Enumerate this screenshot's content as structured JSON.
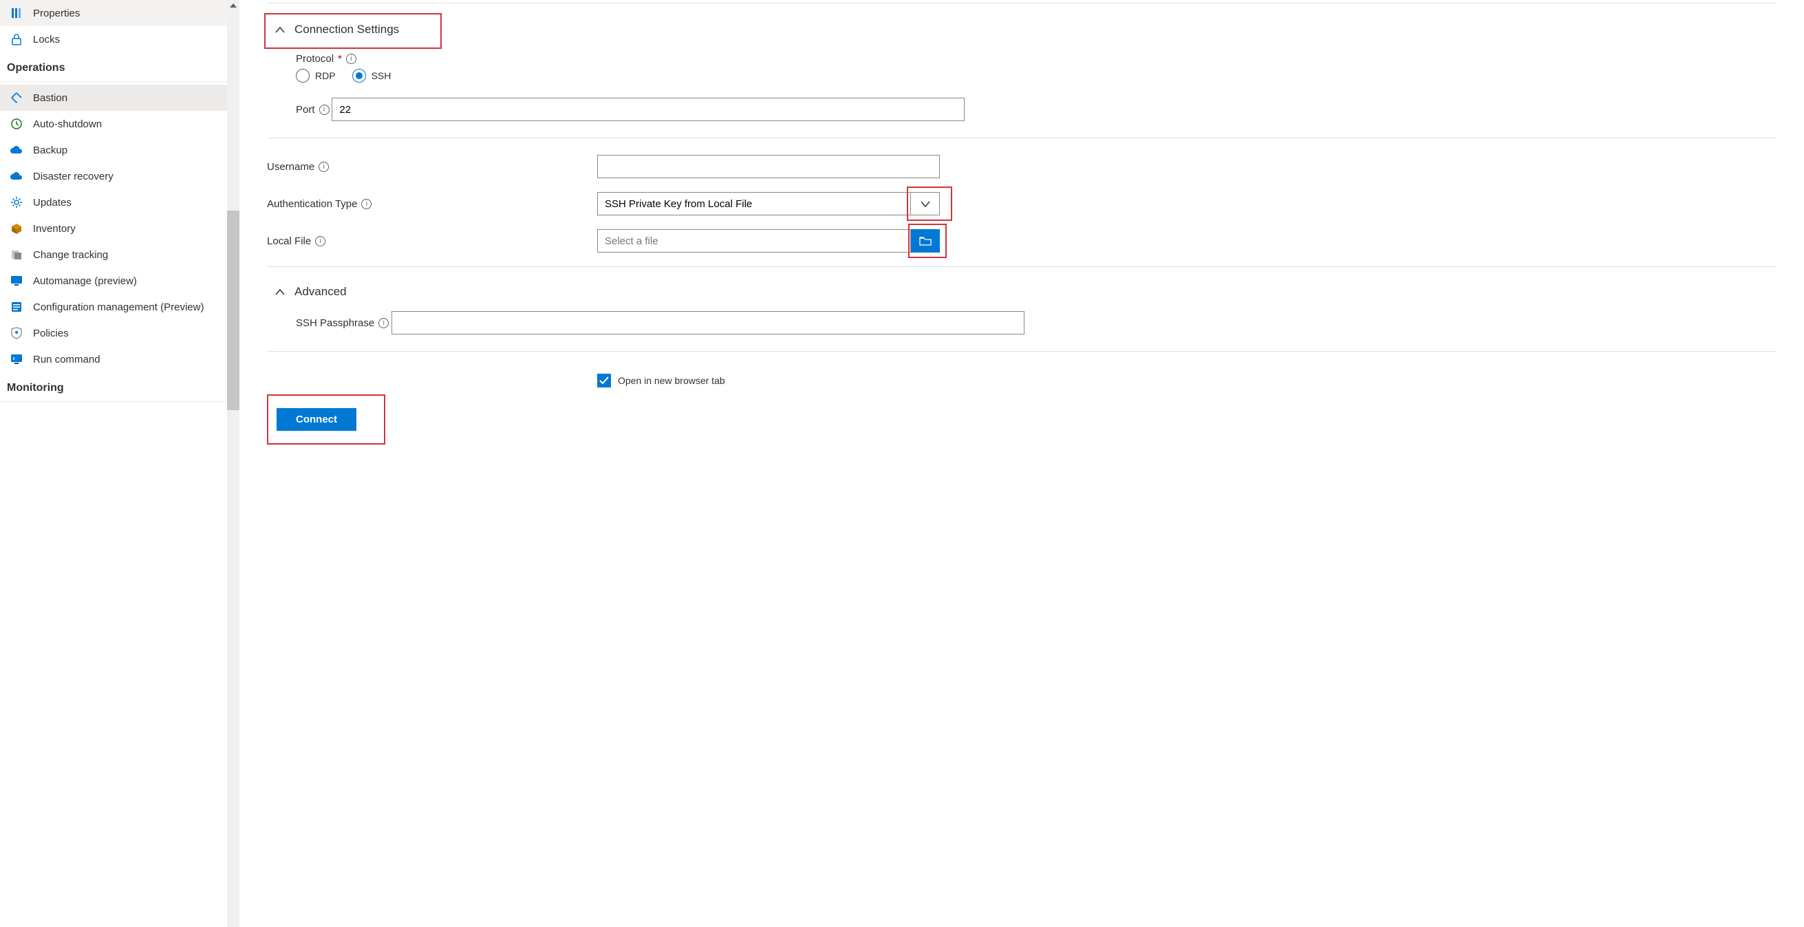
{
  "sidebar": {
    "sections": [
      {
        "items": [
          {
            "id": "properties",
            "label": "Properties"
          },
          {
            "id": "locks",
            "label": "Locks"
          }
        ]
      },
      {
        "header": "Operations",
        "items": [
          {
            "id": "bastion",
            "label": "Bastion",
            "active": true
          },
          {
            "id": "autoshutdown",
            "label": "Auto-shutdown"
          },
          {
            "id": "backup",
            "label": "Backup"
          },
          {
            "id": "dr",
            "label": "Disaster recovery"
          },
          {
            "id": "updates",
            "label": "Updates"
          },
          {
            "id": "inventory",
            "label": "Inventory"
          },
          {
            "id": "changetracking",
            "label": "Change tracking"
          },
          {
            "id": "automanage",
            "label": "Automanage (preview)"
          },
          {
            "id": "configmgmt",
            "label": "Configuration management (Preview)"
          },
          {
            "id": "policies",
            "label": "Policies"
          },
          {
            "id": "runcmd",
            "label": "Run command"
          }
        ]
      },
      {
        "header": "Monitoring",
        "items": []
      }
    ]
  },
  "main": {
    "connection_settings_title": "Connection Settings",
    "protocol": {
      "label": "Protocol",
      "options": {
        "rdp": "RDP",
        "ssh": "SSH"
      },
      "selected": "ssh"
    },
    "port": {
      "label": "Port",
      "value": "22"
    },
    "username": {
      "label": "Username",
      "value": ""
    },
    "auth_type": {
      "label": "Authentication Type",
      "value": "SSH Private Key from Local File"
    },
    "local_file": {
      "label": "Local File",
      "placeholder": "Select a file"
    },
    "advanced_title": "Advanced",
    "passphrase": {
      "label": "SSH Passphrase",
      "value": ""
    },
    "open_new_tab": {
      "label": "Open in new browser tab",
      "checked": true
    },
    "connect_button": "Connect"
  }
}
